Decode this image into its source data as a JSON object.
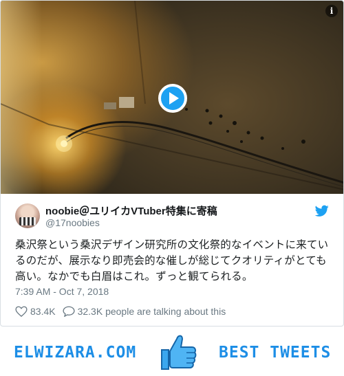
{
  "media": {
    "info_icon": "info-icon",
    "play_icon": "play-icon",
    "info_label": "i"
  },
  "author": {
    "name": "noobie＠ユリイカVTuber特集に寄稿",
    "handle": "@17noobies"
  },
  "tweet": {
    "text": "桑沢祭という桑沢デザイン研究所の文化祭的なイベントに来ているのだが、展示なり即売会的な催しが総じてクオリティがとても高い。なかでも白眉はこれ。ずっと観てられる。",
    "timestamp": "7:39 AM - Oct 7, 2018",
    "likes": "83.4K",
    "talking": "32.3K people are talking about this"
  },
  "banner": {
    "left": "ELWIZARA.COM",
    "right": "BEST TWEETS"
  },
  "colors": {
    "accent": "#1da1f2",
    "banner_text": "#1d8ee6",
    "muted": "#697882"
  }
}
